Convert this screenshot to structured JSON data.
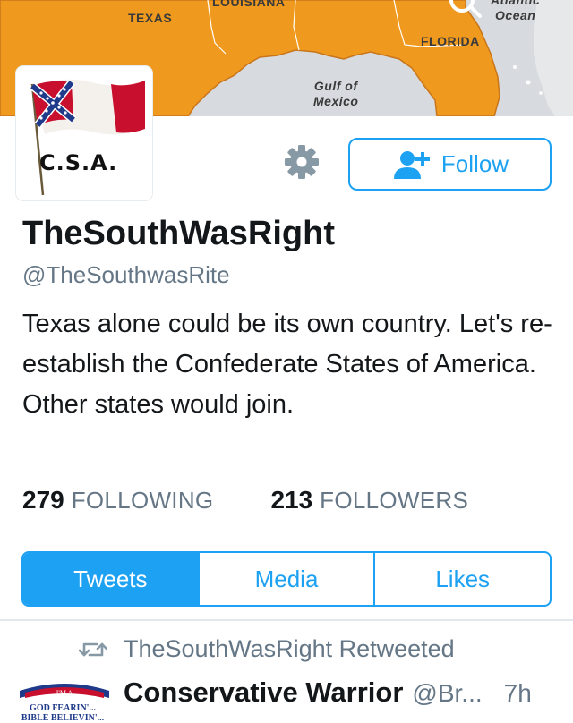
{
  "header": {
    "map_labels": {
      "louisiana": "LOUISIANA",
      "texas": "TEXAS",
      "florida": "FLORIDA",
      "atlantic": "Atlantic\nOcean",
      "gulf": "Gulf of\nMexico"
    },
    "colors": {
      "land": "#ef9a1e",
      "water": "#d9dde0",
      "land_edge": "#c9751a"
    }
  },
  "avatar": {
    "text": "C.S.A.",
    "icon": "confederate-flag"
  },
  "actions": {
    "settings_icon": "gear-icon",
    "follow_label": "Follow",
    "follow_icon": "add-user-icon",
    "accent": "#1da1f2"
  },
  "profile": {
    "display_name": "TheSouthWasRight",
    "handle": "@TheSouthwasRite",
    "bio": "Texas alone could be its own country. Let's re-establish the Confederate States of America. Other states would join.",
    "following_count": "279",
    "following_label": "FOLLOWING",
    "followers_count": "213",
    "followers_label": "FOLLOWERS"
  },
  "tabs": [
    {
      "label": "Tweets",
      "active": true
    },
    {
      "label": "Media",
      "active": false
    },
    {
      "label": "Likes",
      "active": false
    }
  ],
  "tweet": {
    "retweet_icon": "retweet-icon",
    "retweeted_by": "TheSouthWasRight Retweeted",
    "author_name": "Conservative Warrior",
    "author_handle": "@Br...",
    "time": "7h",
    "avatar_text": {
      "top": "I'M A",
      "line1": "GOD FEARIN'...",
      "line2": "BIBLE BELIEVIN'..."
    }
  }
}
